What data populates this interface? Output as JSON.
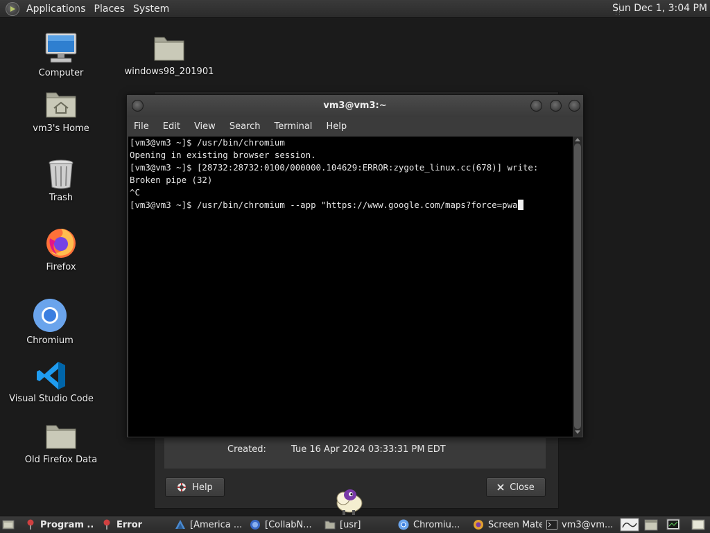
{
  "top_panel": {
    "menus": [
      "Applications",
      "Places",
      "System"
    ],
    "clock": "Sun Dec 1,  3:04 PM"
  },
  "desktop": {
    "icons": [
      {
        "label": "Computer",
        "icon": "computer-icon"
      },
      {
        "label": "windows98_201901",
        "icon": "folder-icon"
      },
      {
        "label": "vm3's Home",
        "icon": "home-folder-icon"
      },
      {
        "label": "Trash",
        "icon": "trash-icon"
      },
      {
        "label": "Firefox",
        "icon": "firefox-icon"
      },
      {
        "label": "Chromium",
        "icon": "chromium-icon"
      },
      {
        "label": "Visual Studio Code",
        "icon": "vscode-icon"
      },
      {
        "label": "Old Firefox Data",
        "icon": "folder-icon"
      }
    ]
  },
  "terminal": {
    "title": "vm3@vm3:~",
    "menu": [
      "File",
      "Edit",
      "View",
      "Search",
      "Terminal",
      "Help"
    ],
    "lines": [
      "[vm3@vm3 ~]$ /usr/bin/chromium",
      "Opening in existing browser session.",
      "[vm3@vm3 ~]$ [28732:28732:0100/000000.104629:ERROR:zygote_linux.cc(678)] write:",
      "Broken pipe (32)",
      "^C",
      "[vm3@vm3 ~]$ /usr/bin/chromium --app \"https://www.google.com/maps?force=pwa"
    ]
  },
  "background_dialog": {
    "created_label": "Created:",
    "created_value": "Tue 16 Apr 2024 03:33:31 PM EDT",
    "help_button": "Help",
    "close_button": "Close"
  },
  "taskbar": {
    "tasks": [
      {
        "label": "Program ...",
        "icon": "error-icon",
        "active": true
      },
      {
        "label": "Error",
        "icon": "error-icon",
        "active": true
      },
      {
        "label": "[America ...",
        "icon": "app-icon",
        "active": false
      },
      {
        "label": "[CollabN...",
        "icon": "firefox-icon",
        "active": false
      },
      {
        "label": "[usr]",
        "icon": "folder-icon",
        "active": false
      },
      {
        "label": "Chromiu...",
        "icon": "chromium-icon",
        "active": false
      },
      {
        "label": "Screen Mate",
        "icon": "screenmate-icon",
        "active": false
      },
      {
        "label": "vm3@vm...",
        "icon": "terminal-icon",
        "active": false
      }
    ]
  },
  "colors": {
    "desktop_bg": "#1b1b1b",
    "panel_bg": "#333333",
    "terminal_bg": "#000000",
    "terminal_fg": "#e6e6e6"
  }
}
